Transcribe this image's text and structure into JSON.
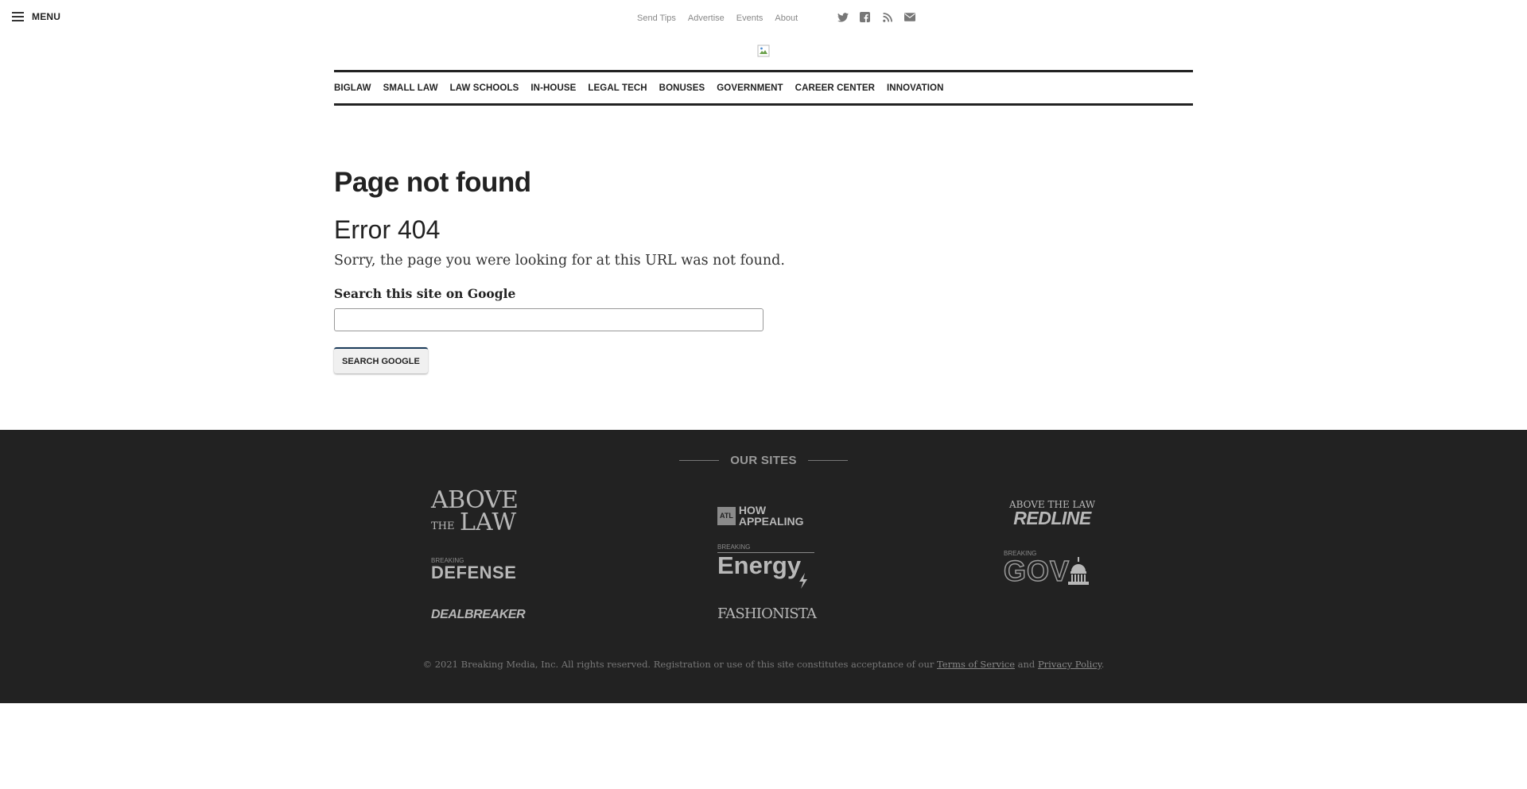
{
  "topbar": {
    "menu_label": "MENU",
    "util_links": [
      "Send Tips",
      "Advertise",
      "Events",
      "About"
    ],
    "social_icons": [
      "twitter-icon",
      "facebook-icon",
      "rss-icon",
      "email-icon"
    ]
  },
  "nav": {
    "items": [
      "BIGLAW",
      "SMALL LAW",
      "LAW SCHOOLS",
      "IN-HOUSE",
      "LEGAL TECH",
      "BONUSES",
      "GOVERNMENT",
      "CAREER CENTER",
      "INNOVATION"
    ]
  },
  "main": {
    "title": "Page not found",
    "error_code": "Error 404",
    "message": "Sorry, the page you were looking for at this URL was not found.",
    "search_label": "Search this site on Google",
    "search_value": "",
    "search_button": "SEARCH GOOGLE"
  },
  "footer": {
    "our_sites": "OUR SITES",
    "sites": {
      "atl_line1": "ABOVE",
      "atl_the": "THE",
      "atl_law": "LAW",
      "how_atl": "ATL",
      "how_line1": "HOW",
      "how_line2": "APPEALING",
      "redline_top": "ABOVE THE LAW",
      "redline_main": "REDLINE",
      "defense_small": "BREAKING",
      "defense_main": "DEFENSE",
      "energy_small": "BREAKING",
      "energy_main": "Energy",
      "gov_small": "BREAKING",
      "gov_main": "GOV",
      "dealbreaker": "DEALBREAKER",
      "fashionista": "FASHIONISTA"
    },
    "copyright_text": "© 2021 Breaking Media, Inc. All rights reserved. Registration or use of this site constitutes acceptance of our",
    "terms": "Terms of Service",
    "and": "and",
    "privacy": "Privacy Policy",
    "period": "."
  },
  "colors": {
    "footer_bg": "#222222",
    "button_top_border": "#1d3d5c"
  }
}
